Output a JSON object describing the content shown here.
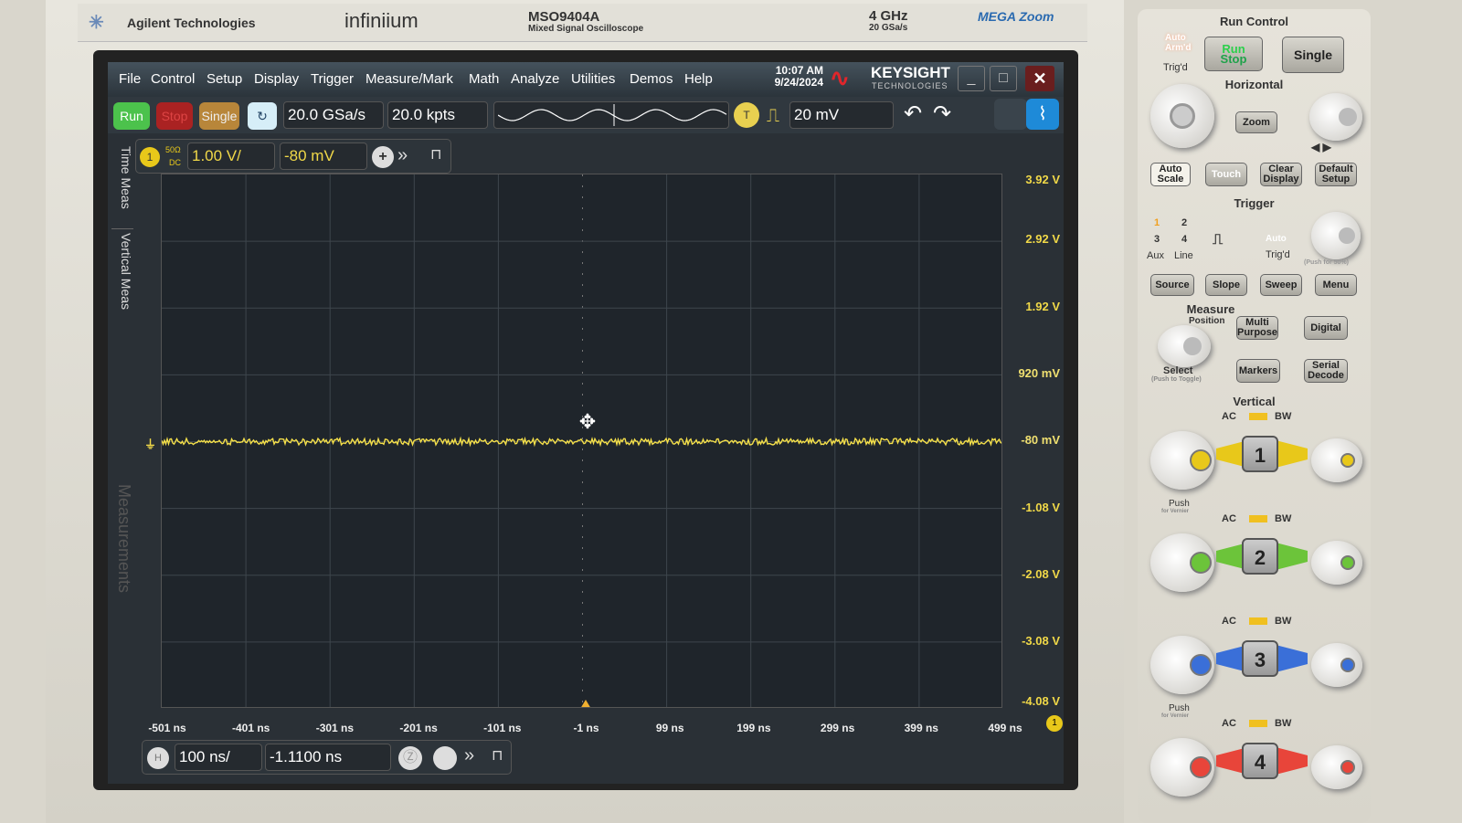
{
  "brand": {
    "maker": "Agilent Technologies",
    "series": "infiniium",
    "model": "MSO9404A",
    "model_desc": "Mixed Signal Oscilloscope",
    "bandwidth": "4 GHz",
    "sample_rate": "20 GSa/s",
    "megazoom": "MEGA Zoom"
  },
  "menu": [
    "File",
    "Control",
    "Setup",
    "Display",
    "Trigger",
    "Measure/Mark",
    "Math",
    "Analyze",
    "Utilities",
    "Demos",
    "Help"
  ],
  "clock": {
    "time": "10:07 AM",
    "date": "9/24/2024"
  },
  "keysight": {
    "name": "KEYSIGHT",
    "sub": "TECHNOLOGIES"
  },
  "toolbar": {
    "run": "Run",
    "stop": "Stop",
    "single": "Single",
    "sample_rate": "20.0 GSa/s",
    "memory": "20.0 kpts",
    "trigger_badge": "T",
    "trigger_level": "20 mV"
  },
  "channel": {
    "number": "1",
    "impedance": "50Ω",
    "coupling": "DC",
    "scale": "1.00 V/",
    "offset": "-80 mV"
  },
  "side_tabs": [
    "Time Meas",
    "Vertical Meas",
    "Measurements"
  ],
  "y_labels": [
    "3.92 V",
    "2.92 V",
    "1.92 V",
    "920 mV",
    "-80 mV",
    "-1.08 V",
    "-2.08 V",
    "-3.08 V",
    "-4.08 V"
  ],
  "x_labels": [
    "-501 ns",
    "-401 ns",
    "-301 ns",
    "-201 ns",
    "-101 ns",
    "-1 ns",
    "99 ns",
    "199 ns",
    "299 ns",
    "399 ns",
    "499 ns"
  ],
  "horizontal": {
    "badge": "H",
    "scale": "100 ns/",
    "position": "-1.1100 ns"
  },
  "trace_color": "#f5e04a",
  "panel": {
    "run_control": "Run Control",
    "arm": "Auto\nArm'd",
    "trigd": "Trig'd",
    "run_stop_run": "Run",
    "run_stop_stop": "Stop",
    "single": "Single",
    "horizontal": "Horizontal",
    "zoom": "Zoom",
    "auto_scale": "Auto Scale",
    "touch": "Touch",
    "clear_display": "Clear Display",
    "default_setup": "Default Setup",
    "trigger": "Trigger",
    "src": [
      "1",
      "2",
      "3",
      "4",
      "Aux",
      "Line"
    ],
    "trig_auto": "Auto",
    "trig_trigd": "Trig'd",
    "push50": "(Push for 50%)",
    "source": "Source",
    "slope": "Slope",
    "sweep": "Sweep",
    "menu": "Menu",
    "measure": "Measure",
    "position": "Position",
    "multi_purpose": "Multi Purpose",
    "digital": "Digital",
    "select": "Select",
    "push_toggle": "(Push to Toggle)",
    "markers": "Markers",
    "serial_decode": "Serial Decode",
    "vertical": "Vertical",
    "ac": "AC",
    "bw": "BW",
    "push": "Push",
    "vernier": "for Vernier",
    "channels": [
      {
        "n": "1",
        "color": "#e8c81a"
      },
      {
        "n": "2",
        "color": "#6cc43a"
      },
      {
        "n": "3",
        "color": "#3a6fd8"
      },
      {
        "n": "4",
        "color": "#e8453a"
      }
    ]
  }
}
